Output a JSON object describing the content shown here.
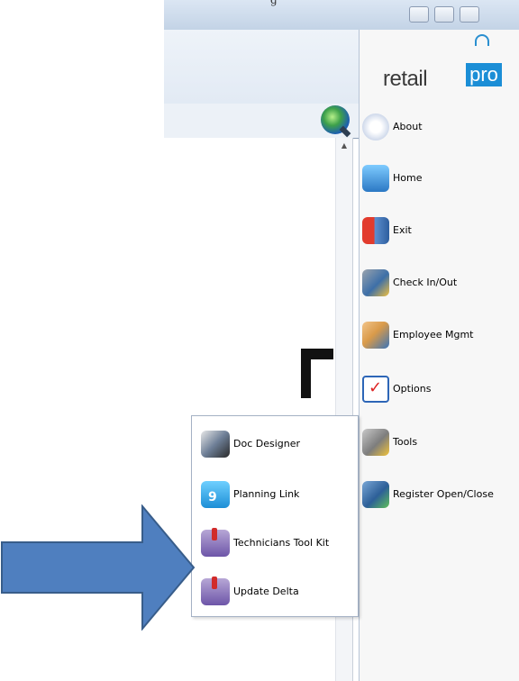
{
  "window": {
    "caption_partial": "g"
  },
  "menu": {
    "items": [
      {
        "label": "About",
        "icon": "retailpro-r-icon"
      },
      {
        "label": "Home",
        "icon": "home-icon"
      },
      {
        "label": "Exit",
        "icon": "exit-door-icon"
      },
      {
        "label": "Check In/Out",
        "icon": "check-in-out-icon"
      },
      {
        "label": "Employee Mgmt",
        "icon": "employee-mgmt-icon"
      },
      {
        "label": "Options",
        "icon": "options-checklist-icon"
      },
      {
        "label": "Tools",
        "icon": "tools-icon"
      },
      {
        "label": "Register Open/Close",
        "icon": "register-icon"
      }
    ]
  },
  "submenu": {
    "items": [
      {
        "label": "Doc Designer",
        "icon": "doc-designer-icon"
      },
      {
        "label": "Planning Link",
        "icon": "planning-link-icon"
      },
      {
        "label": "Technicians Tool Kit",
        "icon": "toolkit-icon"
      },
      {
        "label": "Update Delta",
        "icon": "update-delta-icon"
      }
    ]
  },
  "logo": {
    "text_left": "retail",
    "text_right": "pro"
  },
  "colors": {
    "arrow": "#4f7fbf",
    "arrow_border": "#385d8a",
    "brand_blue": "#1b8ed6"
  }
}
